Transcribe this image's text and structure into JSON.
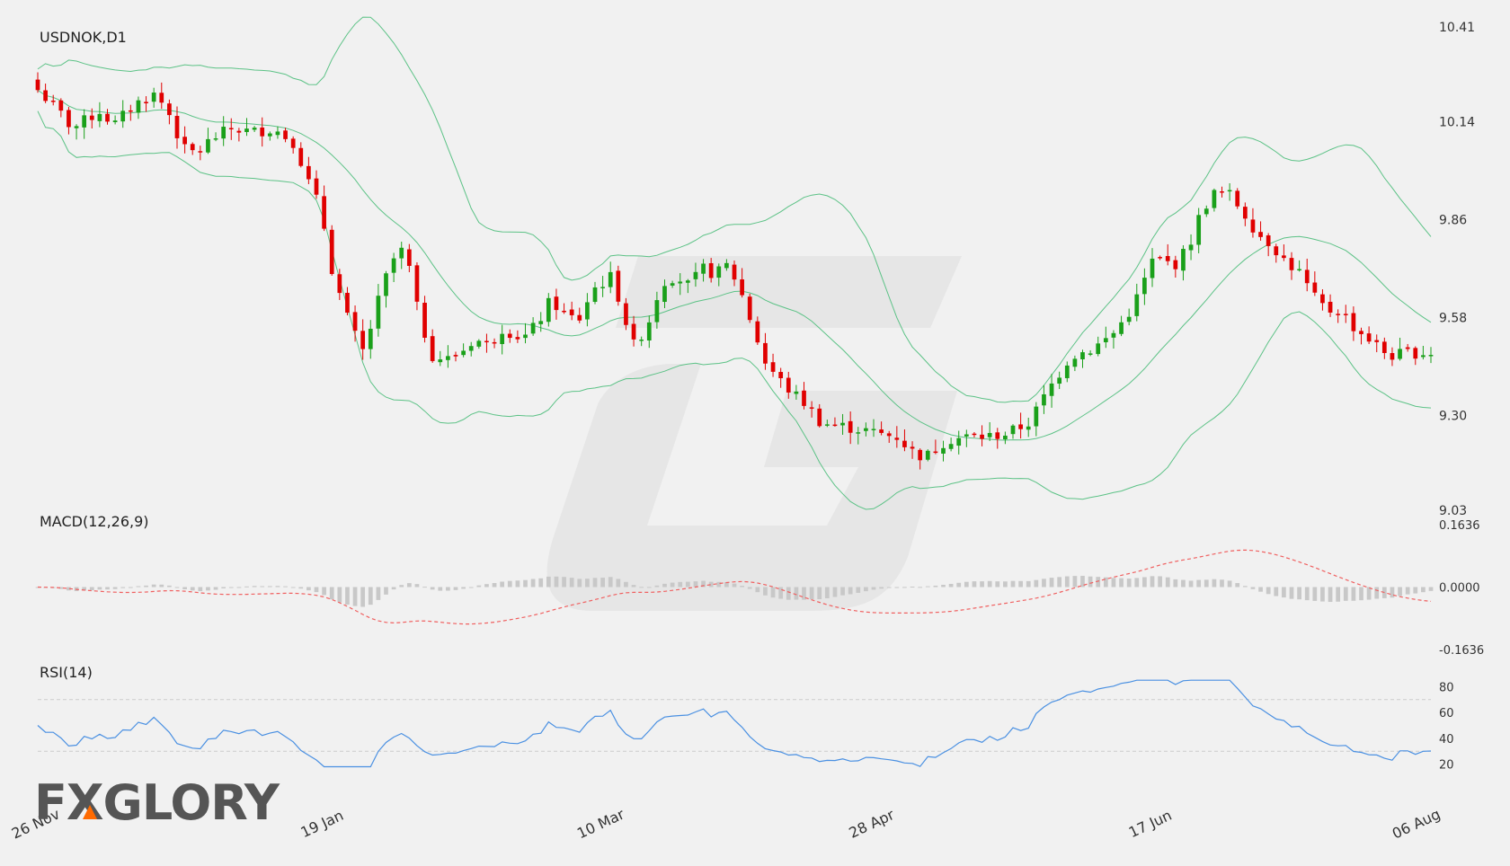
{
  "chart_data": {
    "type": "candlestick",
    "title": "USDNOK,D1",
    "price_axis": {
      "ylim": [
        9.03,
        10.41
      ],
      "ticks": [
        "10.41",
        "10.14",
        "9.86",
        "9.58",
        "9.30",
        "9.03"
      ]
    },
    "x_ticks": [
      {
        "label": "26 Nov",
        "index": 0
      },
      {
        "label": "19 Jan",
        "index": 37
      },
      {
        "label": "10 Mar",
        "index": 73
      },
      {
        "label": "28 Apr",
        "index": 108
      },
      {
        "label": "17 Jun",
        "index": 144
      },
      {
        "label": "06 Aug",
        "index": 180
      }
    ],
    "candles_count": 181,
    "close_anchors": [
      [
        0,
        10.23
      ],
      [
        3,
        10.17
      ],
      [
        5,
        10.12
      ],
      [
        9,
        10.17
      ],
      [
        11,
        10.13
      ],
      [
        14,
        10.19
      ],
      [
        17,
        10.22
      ],
      [
        19,
        10.16
      ],
      [
        21,
        10.06
      ],
      [
        23,
        10.05
      ],
      [
        25,
        10.09
      ],
      [
        28,
        10.12
      ],
      [
        31,
        10.11
      ],
      [
        34,
        10.12
      ],
      [
        37,
        10.08
      ],
      [
        39,
        9.97
      ],
      [
        41,
        9.88
      ],
      [
        42,
        9.75
      ],
      [
        43,
        9.68
      ],
      [
        45,
        9.56
      ],
      [
        47,
        9.48
      ],
      [
        49,
        9.62
      ],
      [
        51,
        9.74
      ],
      [
        53,
        9.78
      ],
      [
        55,
        9.58
      ],
      [
        57,
        9.47
      ],
      [
        59,
        9.46
      ],
      [
        61,
        9.48
      ],
      [
        63,
        9.52
      ],
      [
        65,
        9.5
      ],
      [
        67,
        9.55
      ],
      [
        70,
        9.52
      ],
      [
        72,
        9.56
      ],
      [
        74,
        9.63
      ],
      [
        76,
        9.59
      ],
      [
        78,
        9.57
      ],
      [
        80,
        9.66
      ],
      [
        83,
        9.7
      ],
      [
        84,
        9.62
      ],
      [
        86,
        9.5
      ],
      [
        88,
        9.56
      ],
      [
        90,
        9.68
      ],
      [
        92,
        9.7
      ],
      [
        94,
        9.67
      ],
      [
        96,
        9.72
      ],
      [
        98,
        9.7
      ],
      [
        99,
        9.74
      ],
      [
        101,
        9.68
      ],
      [
        102,
        9.62
      ],
      [
        105,
        9.45
      ],
      [
        108,
        9.38
      ],
      [
        111,
        9.33
      ],
      [
        113,
        9.28
      ],
      [
        116,
        9.27
      ],
      [
        119,
        9.26
      ],
      [
        121,
        9.25
      ],
      [
        124,
        9.24
      ],
      [
        126,
        9.2
      ],
      [
        128,
        9.18
      ],
      [
        131,
        9.23
      ],
      [
        134,
        9.24
      ],
      [
        137,
        9.24
      ],
      [
        140,
        9.25
      ],
      [
        143,
        9.28
      ],
      [
        146,
        9.38
      ],
      [
        149,
        9.47
      ],
      [
        152,
        9.49
      ],
      [
        155,
        9.53
      ],
      [
        158,
        9.61
      ],
      [
        161,
        9.75
      ],
      [
        164,
        9.73
      ],
      [
        166,
        9.78
      ],
      [
        168,
        9.89
      ],
      [
        170,
        9.94
      ],
      [
        172,
        9.93
      ],
      [
        174,
        9.88
      ],
      [
        176,
        9.82
      ],
      [
        178,
        9.79
      ],
      [
        180,
        9.74
      ],
      [
        182,
        9.71
      ],
      [
        184,
        9.64
      ],
      [
        186,
        9.6
      ],
      [
        188,
        9.6
      ],
      [
        190,
        9.55
      ],
      [
        192,
        9.52
      ],
      [
        195,
        9.47
      ],
      [
        198,
        9.48
      ],
      [
        201,
        9.48
      ]
    ],
    "macd": {
      "label": "MACD(12,26,9)",
      "ylim": [
        -0.1636,
        0.1636
      ],
      "ticks": [
        "0.1636",
        "0.0000",
        "-0.1636"
      ]
    },
    "rsi": {
      "label": "RSI(14)",
      "ylim": [
        10,
        90
      ],
      "ticks": [
        "80",
        "60",
        "40",
        "20"
      ],
      "levels": [
        70,
        30
      ]
    },
    "colors": {
      "bull": "#1aa01a",
      "bear": "#e00000",
      "bands": "#5cc286",
      "macd_signal": "#f06060",
      "macd_hist": "#c8c8c8",
      "rsi_line": "#4a90e2",
      "grid": "#cccccc",
      "background": "#f1f1f1"
    }
  },
  "logo": {
    "text": "FXGLORY",
    "accent": "#ff6a00"
  }
}
